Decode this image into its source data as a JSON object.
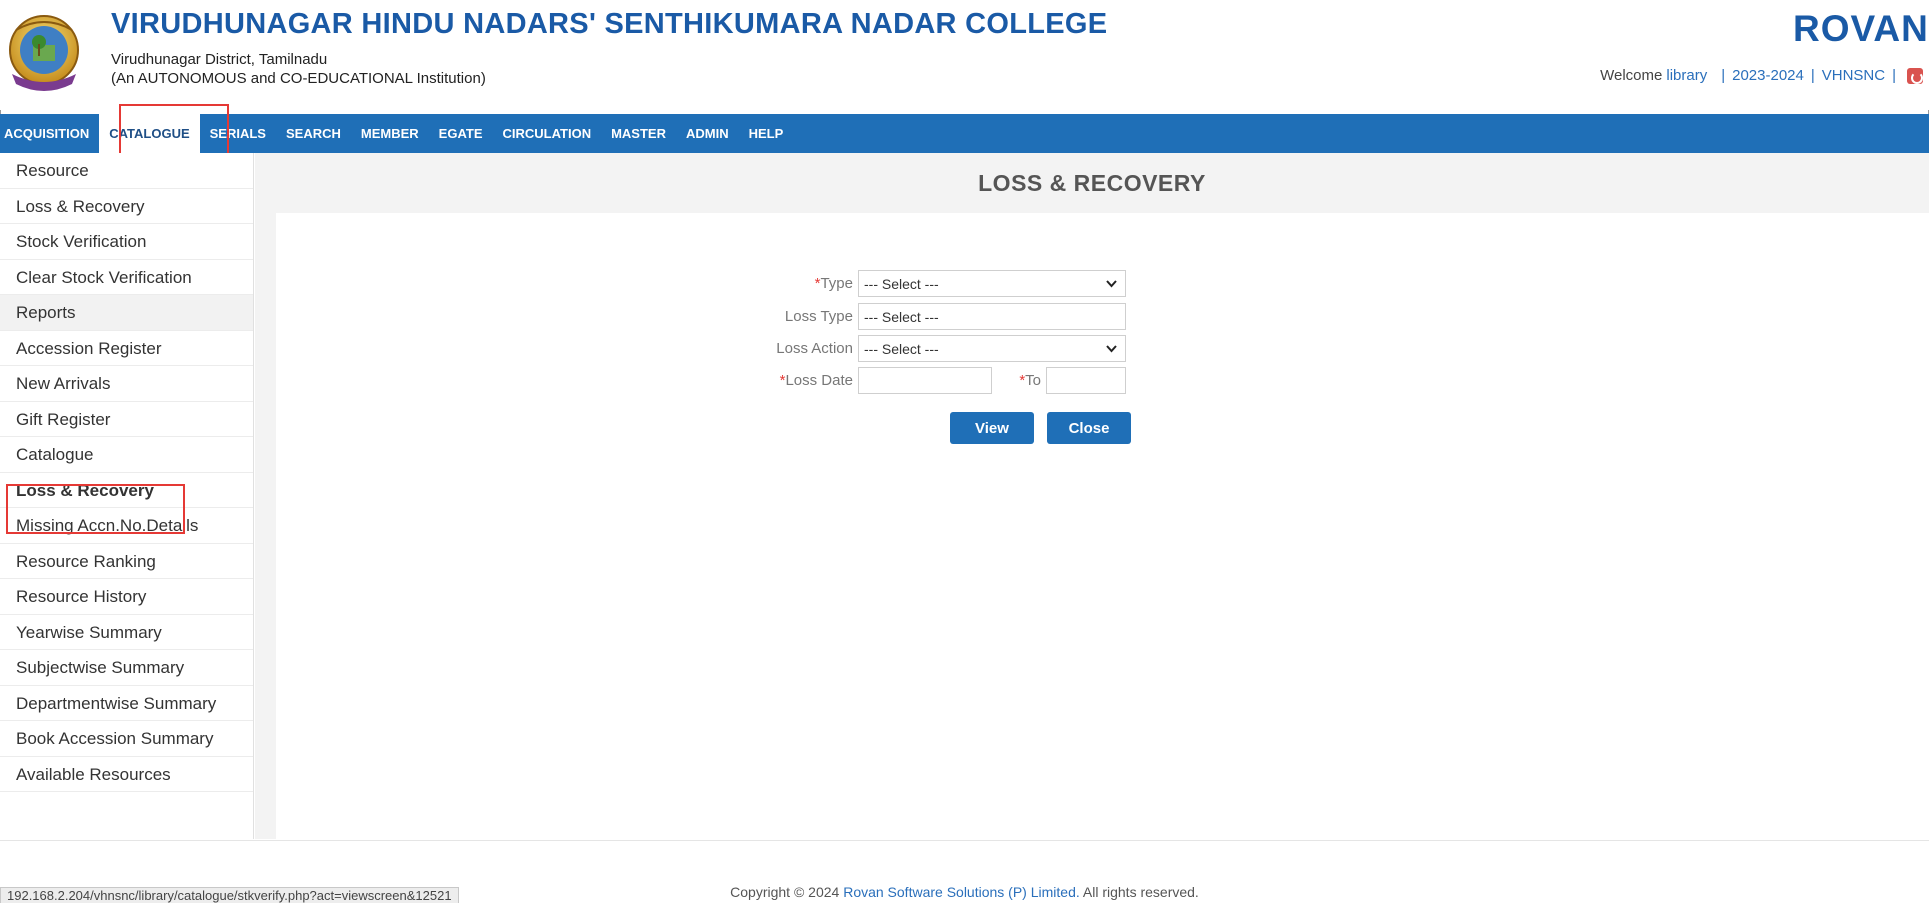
{
  "header": {
    "college_name": "VIRUDHUNAGAR HINDU NADARS' SENTHIKUMARA NADAR COLLEGE",
    "district": "Virudhunagar District, Tamilnadu",
    "institution_type": "(An AUTONOMOUS and CO-EDUCATIONAL Institution)",
    "brand": "ROVAN",
    "brand_mark": "®",
    "welcome_label": "Welcome",
    "welcome_user": "library",
    "academic_year": "2023-2024",
    "institution_code": "VHNSNC",
    "separator": "|",
    "logout_icon": "power-icon"
  },
  "nav": {
    "items": [
      {
        "label": "ACQUISITION",
        "active": false
      },
      {
        "label": "CATALOGUE",
        "active": true
      },
      {
        "label": "SERIALS",
        "active": false
      },
      {
        "label": "SEARCH",
        "active": false
      },
      {
        "label": "MEMBER",
        "active": false
      },
      {
        "label": "EGATE",
        "active": false
      },
      {
        "label": "CIRCULATION",
        "active": false
      },
      {
        "label": "MASTER",
        "active": false
      },
      {
        "label": "ADMIN",
        "active": false
      },
      {
        "label": "HELP",
        "active": false
      }
    ],
    "bar_color": "#1f6fb7"
  },
  "sidebar": {
    "items": [
      {
        "label": "Resource",
        "kind": "link"
      },
      {
        "label": "Loss & Recovery",
        "kind": "link"
      },
      {
        "label": "Stock Verification",
        "kind": "link"
      },
      {
        "label": "Clear Stock Verification",
        "kind": "link"
      },
      {
        "label": "Reports",
        "kind": "header"
      },
      {
        "label": "Accession Register",
        "kind": "link"
      },
      {
        "label": "New Arrivals",
        "kind": "link"
      },
      {
        "label": "Gift Register",
        "kind": "link"
      },
      {
        "label": "Catalogue",
        "kind": "link"
      },
      {
        "label": "Loss & Recovery",
        "kind": "active"
      },
      {
        "label": "Missing Accn.No.Details",
        "kind": "link"
      },
      {
        "label": "Resource Ranking",
        "kind": "link"
      },
      {
        "label": "Resource History",
        "kind": "link"
      },
      {
        "label": "Yearwise Summary",
        "kind": "link"
      },
      {
        "label": "Subjectwise Summary",
        "kind": "link"
      },
      {
        "label": "Departmentwise Summary",
        "kind": "link"
      },
      {
        "label": "Book Accession Summary",
        "kind": "link"
      },
      {
        "label": "Available Resources",
        "kind": "link"
      }
    ],
    "collapse_icon": "caret-left-icon"
  },
  "main": {
    "title": "LOSS & RECOVERY",
    "form": {
      "required_mark": "*",
      "type_label": "Type",
      "type_value": "--- Select ---",
      "loss_type_label": "Loss Type",
      "loss_type_value": "--- Select ---",
      "loss_action_label": "Loss Action",
      "loss_action_value": "--- Select ---",
      "loss_date_label": "Loss Date",
      "loss_date_value": "",
      "to_label": "To",
      "to_value": ""
    },
    "buttons": {
      "view": "View",
      "close": "Close"
    }
  },
  "footer": {
    "copyright_prefix": "Copyright © 2024",
    "company": "Rovan Software Solutions (P) Limited.",
    "rights": "All rights reserved.",
    "status_url": "192.168.2.204/vhnsnc/library/catalogue/stkverify.php?act=viewscreen&12521"
  },
  "colors": {
    "accent": "#1f6fb7",
    "title_blue": "#1a5aa6",
    "highlight_red": "#e53935"
  }
}
